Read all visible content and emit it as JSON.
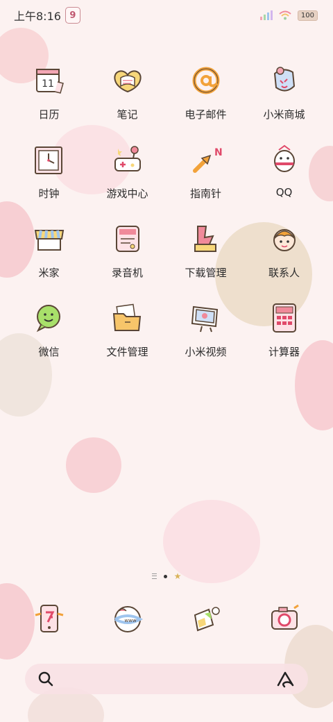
{
  "status_bar": {
    "time": "上午8:16",
    "notification_badge": "9",
    "battery_level": "100",
    "icons": [
      "signal-icon",
      "wifi-icon",
      "battery-icon"
    ]
  },
  "apps": [
    {
      "label": "日历",
      "icon": "calendar-icon",
      "icon_text": "11"
    },
    {
      "label": "笔记",
      "icon": "notes-icon"
    },
    {
      "label": "电子邮件",
      "icon": "email-icon"
    },
    {
      "label": "小米商城",
      "icon": "mi-store-icon"
    },
    {
      "label": "时钟",
      "icon": "clock-icon"
    },
    {
      "label": "游戏中心",
      "icon": "game-center-icon"
    },
    {
      "label": "指南针",
      "icon": "compass-icon",
      "icon_text": "N"
    },
    {
      "label": "QQ",
      "icon": "qq-icon"
    },
    {
      "label": "米家",
      "icon": "mi-home-icon"
    },
    {
      "label": "录音机",
      "icon": "recorder-icon"
    },
    {
      "label": "下载管理",
      "icon": "download-icon"
    },
    {
      "label": "联系人",
      "icon": "contacts-icon"
    },
    {
      "label": "微信",
      "icon": "wechat-icon"
    },
    {
      "label": "文件管理",
      "icon": "file-manager-icon"
    },
    {
      "label": "小米视频",
      "icon": "mi-video-icon"
    },
    {
      "label": "计算器",
      "icon": "calculator-icon"
    }
  ],
  "page_indicator": {
    "pages": 2,
    "active": 1
  },
  "dock": [
    {
      "icon": "phone-icon"
    },
    {
      "icon": "browser-icon",
      "icon_text": "www"
    },
    {
      "icon": "gallery-icon"
    },
    {
      "icon": "camera-icon"
    }
  ],
  "search_bar": {
    "left_icon": "search-icon",
    "right_icon": "assistant-icon"
  },
  "colors": {
    "background": "#fcf2f1",
    "accent_pink": "#f3a6b4",
    "outline": "#5a4636",
    "yellow": "#f7d77a"
  }
}
